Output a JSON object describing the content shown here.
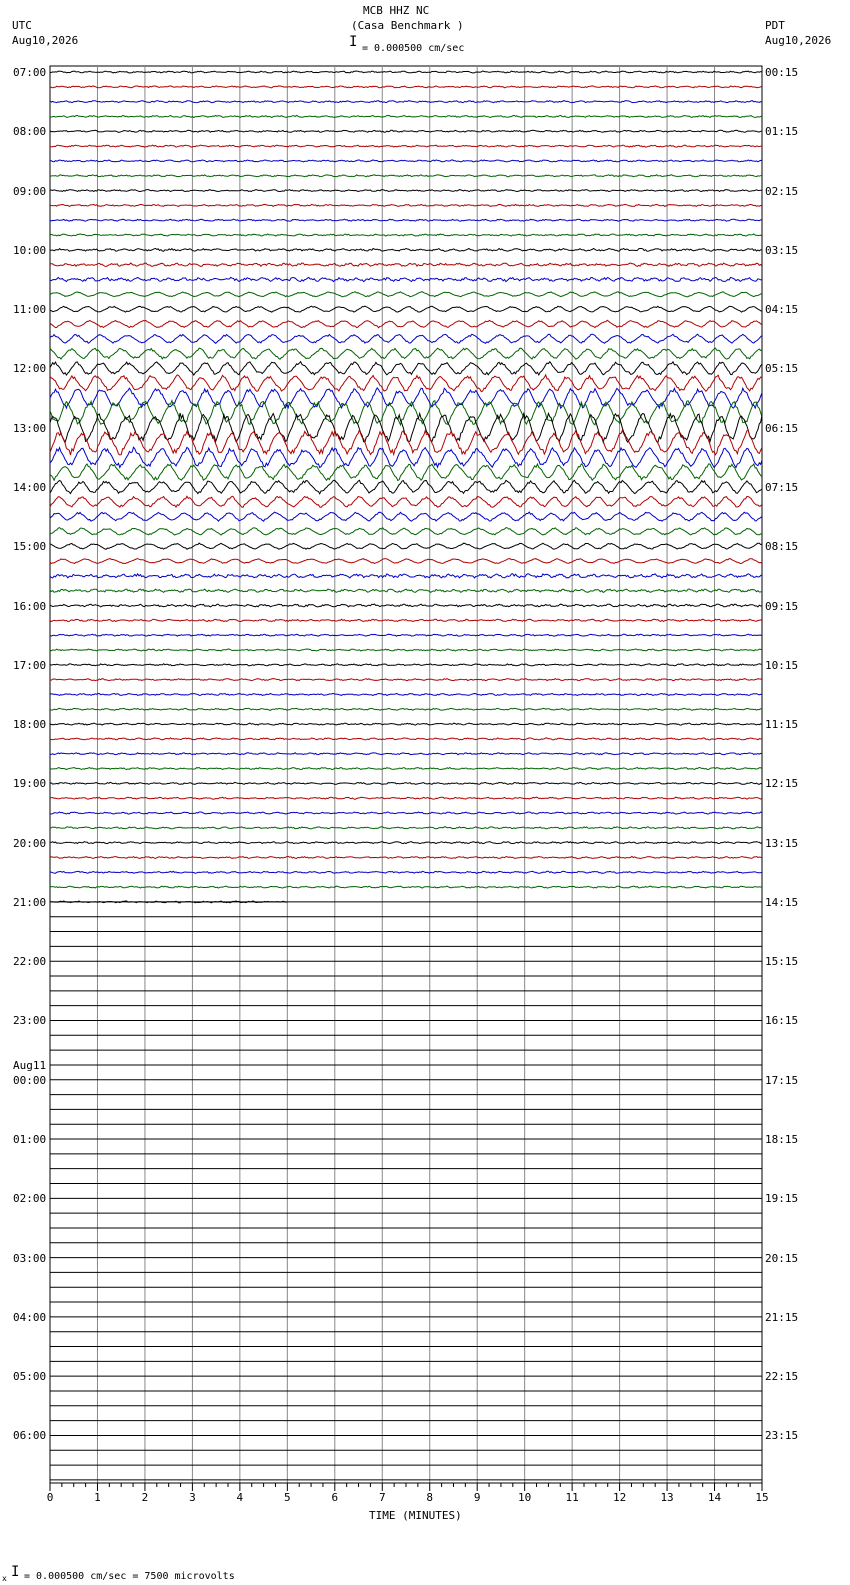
{
  "header": {
    "station": "MCB HHZ NC",
    "site": "(Casa Benchmark )",
    "scale_label": "= 0.000500 cm/sec",
    "left_zone": "UTC",
    "left_date": "Aug10,2026",
    "right_zone": "PDT",
    "right_date": "Aug10,2026"
  },
  "footer": {
    "scale_label": "= 0.000500 cm/sec =    7500 microvolts",
    "marker": "x"
  },
  "chart_data": {
    "type": "line",
    "title": "MCB HHZ NC (Casa Benchmark )",
    "xlabel": "TIME (MINUTES)",
    "ylabel": "",
    "xlim": [
      0,
      15
    ],
    "x_ticks": [
      "0",
      "1",
      "2",
      "3",
      "4",
      "5",
      "6",
      "7",
      "8",
      "9",
      "10",
      "11",
      "12",
      "13",
      "14",
      "15"
    ],
    "rows_per_hour": 4,
    "total_rows": 96,
    "trace_colors": [
      "#000000",
      "#b00000",
      "#0000c8",
      "#006400"
    ],
    "left_hour_labels": [
      "07:00",
      "08:00",
      "09:00",
      "10:00",
      "11:00",
      "12:00",
      "13:00",
      "14:00",
      "15:00",
      "16:00",
      "17:00",
      "18:00",
      "19:00",
      "20:00",
      "21:00",
      "22:00",
      "23:00",
      "00:00",
      "01:00",
      "02:00",
      "03:00",
      "04:00",
      "05:00",
      "06:00"
    ],
    "day_change": {
      "hour_index": 17,
      "label": "Aug11"
    },
    "right_hour_labels": [
      "00:15",
      "01:15",
      "02:15",
      "03:15",
      "04:15",
      "05:15",
      "06:15",
      "07:15",
      "08:15",
      "09:15",
      "10:15",
      "11:15",
      "12:15",
      "13:15",
      "14:15",
      "15:15",
      "16:15",
      "17:15",
      "18:15",
      "19:15",
      "20:15",
      "21:15",
      "22:15",
      "23:15"
    ],
    "data_rows": 57,
    "last_row_end_minutes": 5.0,
    "grid": true
  }
}
